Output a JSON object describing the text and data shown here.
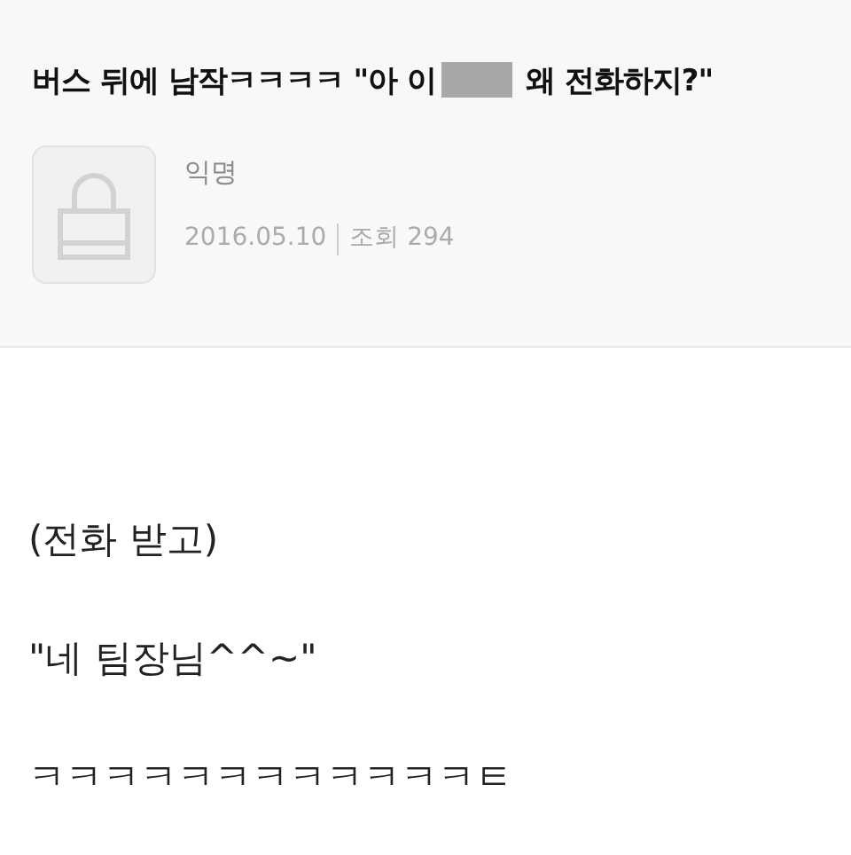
{
  "post": {
    "title_before": "버스 뒤에 남작ㅋㅋㅋㅋ \"아 이",
    "redacted": true,
    "title_after": "왜 전화하지?\"",
    "author": "익명",
    "date": "2016.05.10",
    "views_label": "조회",
    "views": "294"
  },
  "body": [
    "(전화 받고)",
    "\"네 팀장님^^~\"",
    "ㅋㅋㅋㅋㅋㅋㅋㅋㅋㅋㅋㅋㅌ"
  ]
}
